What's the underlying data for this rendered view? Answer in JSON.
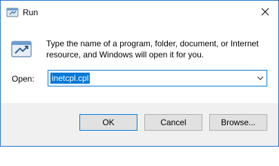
{
  "window": {
    "title": "Run",
    "close_glyph": "✕",
    "title_icon": "run-icon"
  },
  "content": {
    "description": "Type the name of a program, folder, document, or Internet resource, and Windows will open it for you.",
    "open_label": "Open:",
    "open_value": "inetcpl.cpl",
    "icon": "run-dialog-icon"
  },
  "buttons": {
    "ok": "OK",
    "cancel": "Cancel",
    "browse": "Browse..."
  }
}
